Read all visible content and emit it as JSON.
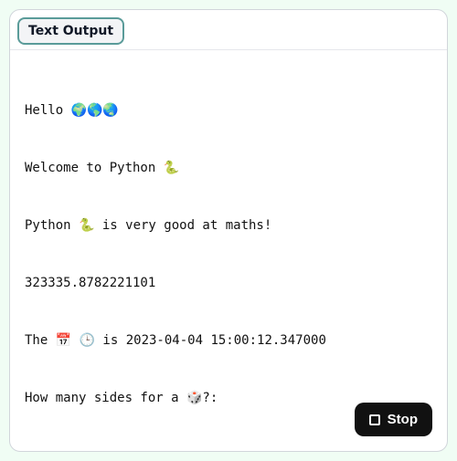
{
  "tab": {
    "label": "Text Output"
  },
  "output": {
    "lines": [
      "Hello 🌍🌎🌏",
      "Welcome to Python 🐍",
      "Python 🐍 is very good at maths!",
      "323335.8782221101",
      "The 📅 🕒 is 2023-04-04 15:00:12.347000",
      "How many sides for a 🎲?:"
    ]
  },
  "controls": {
    "stop_label": "Stop"
  }
}
